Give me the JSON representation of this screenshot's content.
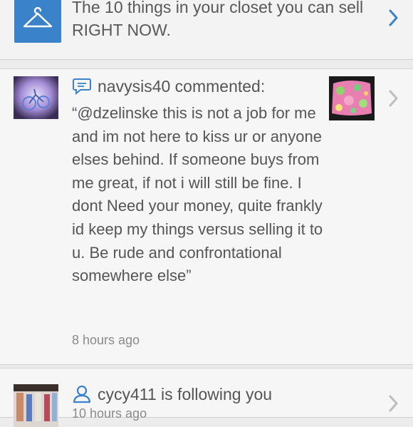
{
  "feed": {
    "listing_card": {
      "icon": "hanger-icon",
      "title": "The 10 things in your closet you can sell RIGHT NOW."
    },
    "comment_card": {
      "icon": "comment-bubble-icon",
      "actor_line": "navysis40 commented:",
      "comment": "“@dzelinske this is not a job for me and im not here to kiss ur or anyone elses behind. If someone buys from me great, if not i will still be fine. I dont Need your money, quite frankly id keep my things versus selling it to u. Be rude and confrontational somewhere else”",
      "time": "8 hours ago"
    },
    "follow_card": {
      "icon": "person-outline-icon",
      "actor_line": "cycy411 is following you",
      "time": "10 hours ago"
    }
  },
  "colors": {
    "accent_blue": "#3a82c9",
    "chevron_blue": "#3a82c9",
    "chevron_gray": "#bdbdbd",
    "text": "#555555",
    "muted": "#8a8a8a"
  }
}
